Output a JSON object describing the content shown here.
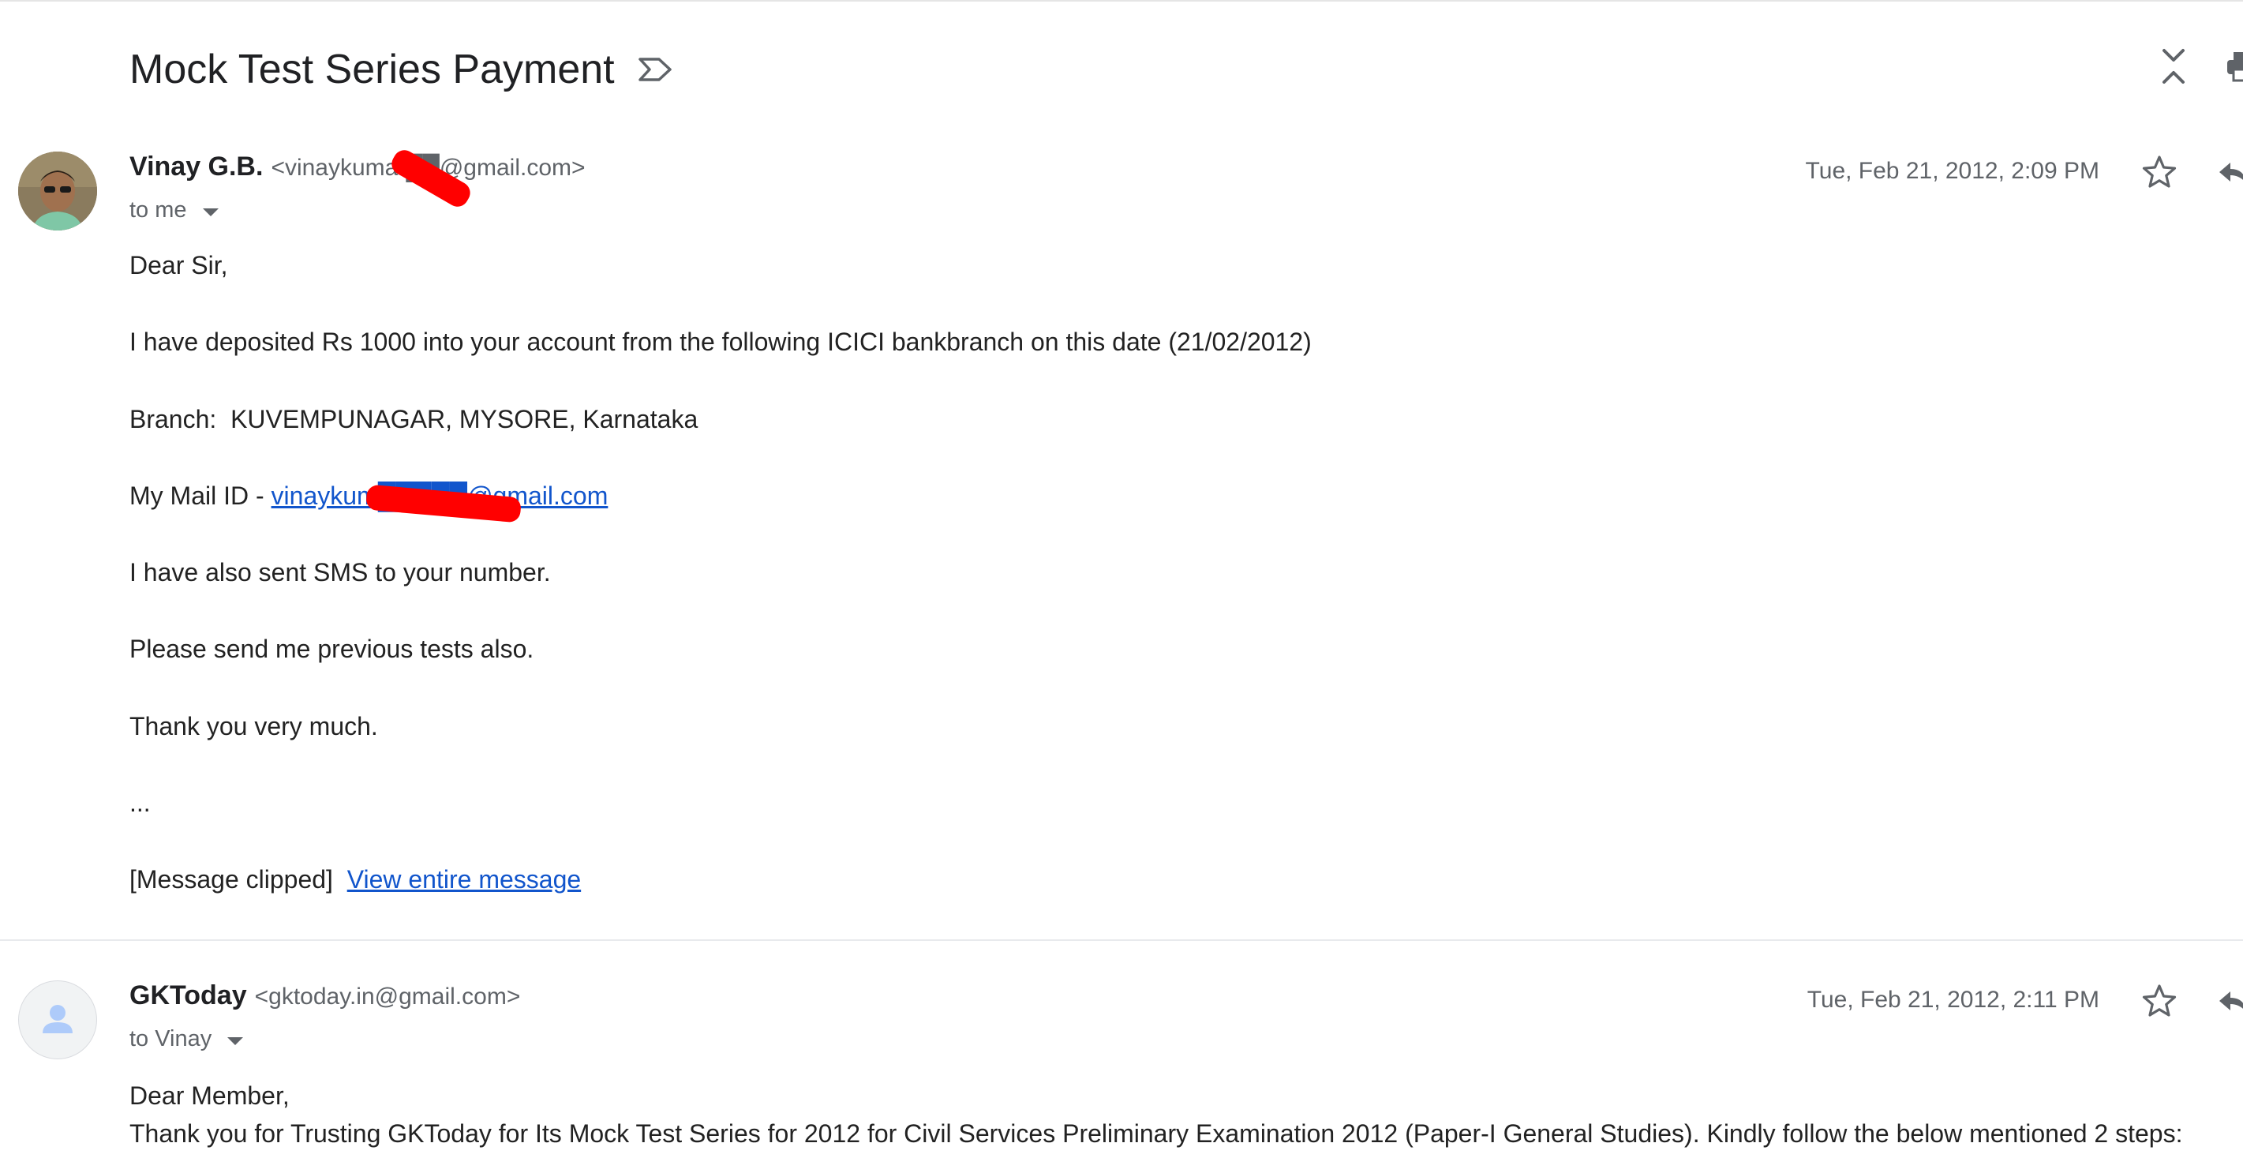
{
  "thread": {
    "subject": "Mock Test Series Payment"
  },
  "messages": [
    {
      "sender_name": "Vinay G.B.",
      "sender_email": "<vinaykumar██@gmail.com>",
      "recipient": "to me",
      "date": "Tue, Feb 21, 2012, 2:09 PM",
      "greeting": "Dear Sir,",
      "line_deposit": "I have deposited Rs 1000 into your account from the following ICICI bankbranch on this date (21/02/2012)",
      "line_branch": "Branch:  KUVEMPUNAGAR, MYSORE, Karnataka",
      "mail_id_prefix": "My Mail ID - ",
      "mail_id_link": "vinaykum█████@gmail.com",
      "line_sms": "I have also sent SMS to your number.",
      "line_tests": "Please send me previous tests also.",
      "line_thanks": "Thank you very much.",
      "ellipsis": "...",
      "clipped_label": "[Message clipped]",
      "view_entire_label": "View entire message"
    },
    {
      "sender_name": "GKToday",
      "sender_email": "<gktoday.in@gmail.com>",
      "recipient": "to Vinay",
      "date": "Tue, Feb 21, 2012, 2:11 PM",
      "greeting": "Dear Member,",
      "line_1": "Thank you for Trusting GKToday for Its Mock Test Series for 2012 for Civil Services Preliminary Examination 2012 (Paper-I General Studies). Kindly follow the below mentioned 2 steps:"
    }
  ],
  "icons": {
    "label": "label-icon",
    "collapse": "collapse-all-icon",
    "print": "print-icon",
    "star": "star-icon",
    "reply": "reply-icon",
    "caret": "caret-down-icon",
    "default_avatar": "person-icon"
  },
  "colors": {
    "link": "#1155cc",
    "redaction": "#ff0000",
    "secondary_text": "#5f6368"
  }
}
